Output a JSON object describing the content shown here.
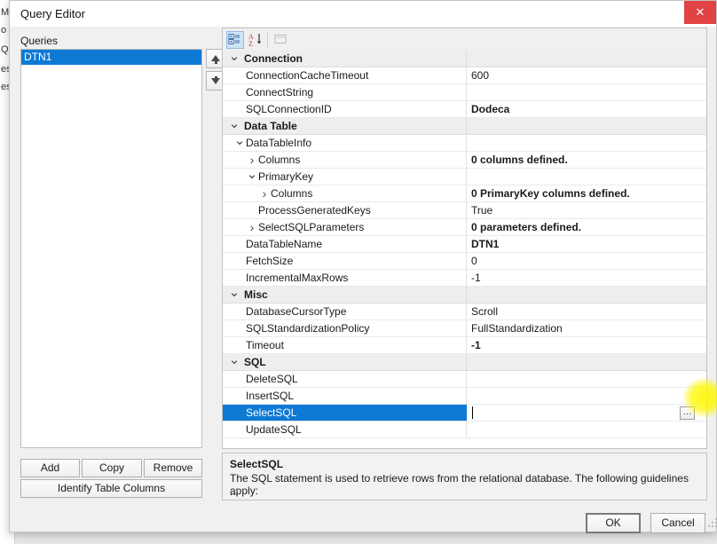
{
  "background_window": {
    "fragments": [
      "Mi",
      "o",
      "Qu",
      "es",
      "es"
    ]
  },
  "dialog": {
    "title": "Query Editor",
    "close_label": "✕"
  },
  "queries_pane": {
    "label": "Queries",
    "items": [
      {
        "name": "DTN1",
        "selected": true
      }
    ],
    "move_up_tooltip": "Move Up",
    "move_down_tooltip": "Move Down",
    "buttons": {
      "add": "Add",
      "copy": "Copy",
      "remove": "Remove",
      "identify": "Identify Table Columns"
    }
  },
  "property_grid": {
    "toolbar": {
      "categorized": "categorized-view-icon",
      "alphabetical": "sort-alphabetical-icon",
      "property_pages": "property-pages-icon"
    },
    "rows": [
      {
        "kind": "category",
        "name": "Connection",
        "value": "",
        "indent": 0,
        "chevron": "down",
        "bold_value": false
      },
      {
        "kind": "property",
        "name": "ConnectionCacheTimeout",
        "value": "600",
        "indent": 1,
        "chevron": "",
        "bold_value": false
      },
      {
        "kind": "property",
        "name": "ConnectString",
        "value": "",
        "indent": 1,
        "chevron": "",
        "bold_value": false
      },
      {
        "kind": "property",
        "name": "SQLConnectionID",
        "value": "Dodeca",
        "indent": 1,
        "chevron": "",
        "bold_value": true
      },
      {
        "kind": "category",
        "name": "Data Table",
        "value": "",
        "indent": 0,
        "chevron": "down",
        "bold_value": false
      },
      {
        "kind": "property",
        "name": "DataTableInfo",
        "value": "",
        "indent": 1,
        "chevron": "down",
        "bold_value": false
      },
      {
        "kind": "property",
        "name": "Columns",
        "value": "0 columns defined.",
        "indent": 2,
        "chevron": "right",
        "bold_value": true
      },
      {
        "kind": "property",
        "name": "PrimaryKey",
        "value": "",
        "indent": 2,
        "chevron": "down",
        "bold_value": false
      },
      {
        "kind": "property",
        "name": "Columns",
        "value": "0 PrimaryKey columns defined.",
        "indent": 3,
        "chevron": "right",
        "bold_value": true
      },
      {
        "kind": "property",
        "name": "ProcessGeneratedKeys",
        "value": "True",
        "indent": 2,
        "chevron": "",
        "bold_value": false
      },
      {
        "kind": "property",
        "name": "SelectSQLParameters",
        "value": "0 parameters defined.",
        "indent": 2,
        "chevron": "right",
        "bold_value": true
      },
      {
        "kind": "property",
        "name": "DataTableName",
        "value": "DTN1",
        "indent": 1,
        "chevron": "",
        "bold_value": true
      },
      {
        "kind": "property",
        "name": "FetchSize",
        "value": "0",
        "indent": 1,
        "chevron": "",
        "bold_value": false
      },
      {
        "kind": "property",
        "name": "IncrementalMaxRows",
        "value": "-1",
        "indent": 1,
        "chevron": "",
        "bold_value": false
      },
      {
        "kind": "category",
        "name": "Misc",
        "value": "",
        "indent": 0,
        "chevron": "down",
        "bold_value": false
      },
      {
        "kind": "property",
        "name": "DatabaseCursorType",
        "value": "Scroll",
        "indent": 1,
        "chevron": "",
        "bold_value": false
      },
      {
        "kind": "property",
        "name": "SQLStandardizationPolicy",
        "value": "FullStandardization",
        "indent": 1,
        "chevron": "",
        "bold_value": false
      },
      {
        "kind": "property",
        "name": "Timeout",
        "value": "-1",
        "indent": 1,
        "chevron": "",
        "bold_value": true
      },
      {
        "kind": "category",
        "name": "SQL",
        "value": "",
        "indent": 0,
        "chevron": "down",
        "bold_value": false
      },
      {
        "kind": "property",
        "name": "DeleteSQL",
        "value": "",
        "indent": 1,
        "chevron": "",
        "bold_value": false
      },
      {
        "kind": "property",
        "name": "InsertSQL",
        "value": "",
        "indent": 1,
        "chevron": "",
        "bold_value": false
      },
      {
        "kind": "property",
        "name": "SelectSQL",
        "value": "",
        "indent": 1,
        "chevron": "",
        "bold_value": false,
        "selected": true,
        "editing": true,
        "ellipsis_label": "…",
        "highlighted": true
      },
      {
        "kind": "property",
        "name": "UpdateSQL",
        "value": "",
        "indent": 1,
        "chevron": "",
        "bold_value": false
      }
    ]
  },
  "description_pane": {
    "title": "SelectSQL",
    "line1": "The SQL statement is used to retrieve rows from the relational database.  The following guidelines apply:",
    "line2": "..."
  },
  "footer": {
    "ok": "OK",
    "cancel": "Cancel"
  },
  "colors": {
    "selection_blue": "#0e7ad4",
    "close_red": "#e04343",
    "highlight_yellow": "#fff600",
    "dialog_bg": "#f0f0f0",
    "category_bg": "#eeeeee"
  }
}
